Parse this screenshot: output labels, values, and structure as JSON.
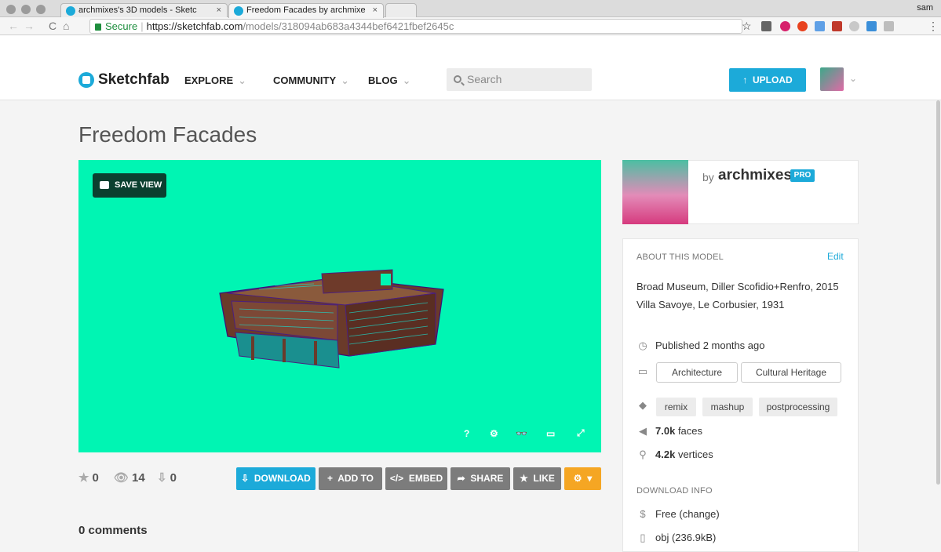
{
  "browser": {
    "tabs": [
      {
        "title": "archmixes's 3D models - Sketc",
        "close": "×"
      },
      {
        "title": "Freedom Facades by archmixe",
        "close": "×"
      }
    ],
    "user": "sam",
    "nav": {
      "back": "←",
      "forward": "→",
      "reload": "C",
      "home": "⌂"
    },
    "address": {
      "secure_label": "Secure",
      "separator": "|",
      "host": "https://sketchfab.com",
      "path": "/models/318094ab683a4344bef6421fbef2645c"
    },
    "star": "☆",
    "menu": "⋮"
  },
  "site": {
    "logo_text": "Sketchfab",
    "nav": [
      {
        "label": "EXPLORE",
        "chev": "⌄"
      },
      {
        "label": "COMMUNITY",
        "chev": "⌄"
      },
      {
        "label": "BLOG",
        "chev": "⌄"
      }
    ],
    "search_placeholder": "Search",
    "upload_label": "UPLOAD",
    "upload_arrow": "↑",
    "avatar_chev": "⌄"
  },
  "model": {
    "title": "Freedom Facades",
    "save_view_label": "SAVE VIEW",
    "viewer_controls": [
      "?",
      "⚙",
      "👓",
      "▭",
      "⤢"
    ],
    "stats": {
      "likes": "0",
      "views": "14",
      "downloads": "0"
    },
    "stat_icons": {
      "likes": "★",
      "views": "👁",
      "downloads": "⇩"
    },
    "actions": [
      {
        "icon": "⇩",
        "label": "DOWNLOAD"
      },
      {
        "icon": "+",
        "label": "ADD TO"
      },
      {
        "icon": "</>",
        "label": "EMBED"
      },
      {
        "icon": "➦",
        "label": "SHARE"
      },
      {
        "icon": "★",
        "label": "LIKE"
      },
      {
        "icon": "⚙",
        "label": "▾"
      }
    ],
    "comments_label": "0 comments"
  },
  "author": {
    "by": "by",
    "name": "archmixes",
    "badge": "PRO"
  },
  "about": {
    "heading": "ABOUT THIS MODEL",
    "edit": "Edit",
    "description": [
      "Broad Museum, Diller Scofidio+Renfro, 2015",
      "Villa Savoye, Le Corbusier, 1931"
    ],
    "published": "Published 2 months ago",
    "categories": [
      "Architecture",
      "Cultural Heritage"
    ],
    "tags": [
      "remix",
      "mashup",
      "postprocessing"
    ],
    "faces_value": "7.0k",
    "faces_label": "faces",
    "vertices_value": "4.2k",
    "vertices_label": "vertices",
    "download_heading": "DOWNLOAD INFO",
    "price": "Free",
    "price_change": "(change)",
    "file": "obj (236.9kB)",
    "icons": {
      "clock": "◷",
      "category": "▭",
      "tag": "◆",
      "faces": "◀",
      "vertices": "⚲",
      "price": "$",
      "file": "▯"
    }
  }
}
